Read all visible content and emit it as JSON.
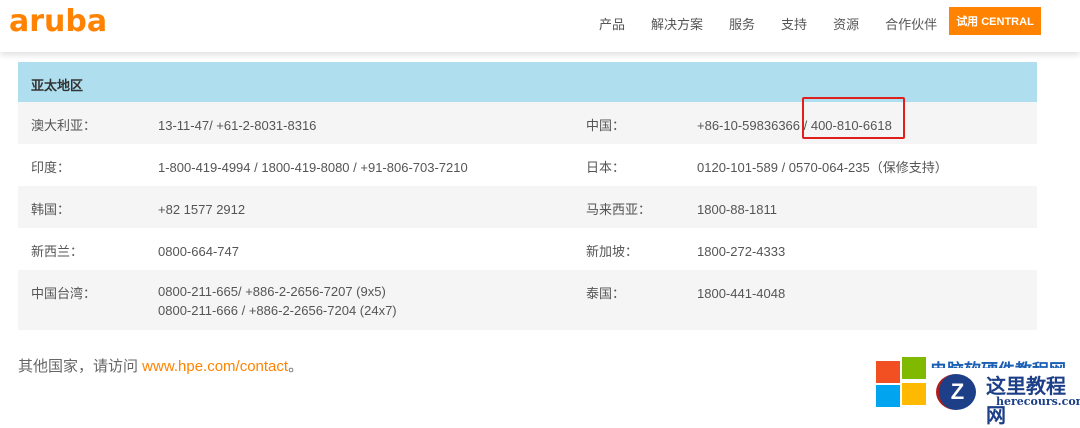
{
  "header": {
    "logo": "aruba",
    "nav": [
      "产品",
      "解决方案",
      "服务",
      "支持",
      "资源",
      "合作伙伴"
    ],
    "cta": "试用 CENTRAL"
  },
  "table": {
    "title": "亚太地区",
    "rows": [
      {
        "l": "澳大利亚：",
        "v": "13-11-47/ +61-2-8031-8316",
        "r": "中国：",
        "rv": "+86-10-59836366 / 400-810-6618"
      },
      {
        "l": "印度：",
        "v": "1-800-419-4994 / 1800-419-8080 / +91-806-703-7210",
        "r": "日本：",
        "rv": "0120-101-589 / 0570-064-235（保修支持）"
      },
      {
        "l": "韩国：",
        "v": "+82 1577 2912",
        "r": "马来西亚：",
        "rv": "1800-88-1811"
      },
      {
        "l": "新西兰：",
        "v": "0800-664-747",
        "r": "新加坡：",
        "rv": "1800-272-4333"
      },
      {
        "l": "中国台湾：",
        "v": "0800-211-665/ +886-2-2656-7207 (9x5)",
        "v2": "0800-211-666 / +886-2-2656-7204 (24x7)",
        "r": "泰国：",
        "rv": "1800-441-4048"
      }
    ]
  },
  "footer": {
    "text": "其他国家，请访问 ",
    "link": "www.hpe.com/contact",
    "suffix": "。"
  },
  "watermark": {
    "line1": "电脑软硬件教程网",
    "line2": "这里教程网",
    "line3": "herecours.com"
  },
  "colors": {
    "accent": "#ff8300",
    "header_bg": "#afdfee",
    "highlight": "#e0201c"
  }
}
